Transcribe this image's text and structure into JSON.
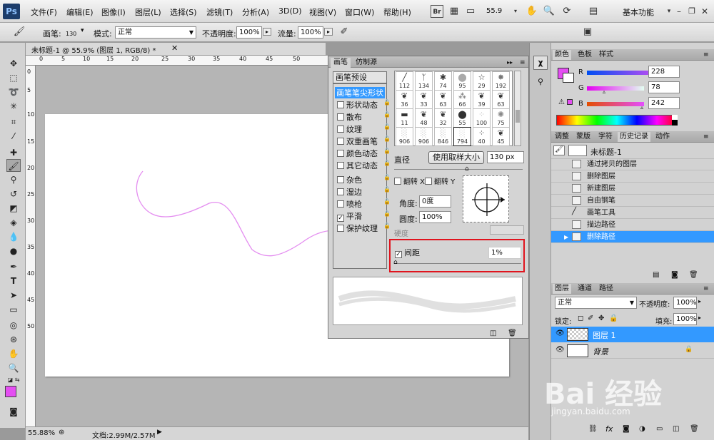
{
  "app": {
    "logo": "Ps"
  },
  "menu": [
    "文件(F)",
    "编辑(E)",
    "图像(I)",
    "图层(L)",
    "选择(S)",
    "滤镜(T)",
    "分析(A)",
    "3D(D)",
    "视图(V)",
    "窗口(W)",
    "帮助(H)"
  ],
  "appbar": {
    "bridge": "Br",
    "zoom": "55.9",
    "workspace": "基本功能"
  },
  "options": {
    "brush_label": "画笔:",
    "brush_size": "130",
    "mode_label": "模式:",
    "mode_value": "正常",
    "opacity_label": "不透明度:",
    "opacity_value": "100%",
    "flow_label": "流量:",
    "flow_value": "100%"
  },
  "document": {
    "tab_title": "未标题-1 @ 55.9% (图层 1, RGB/8) *",
    "zoom": "55.88%",
    "doc_info": "文档:2.99M/2.57M"
  },
  "ruler": {
    "h_ticks": [
      "0",
      "5",
      "10",
      "15",
      "20",
      "25",
      "30",
      "35",
      "40",
      "45",
      "50"
    ],
    "v_ticks": [
      "0",
      "5",
      "10",
      "15",
      "20",
      "25",
      "30",
      "35",
      "40",
      "45",
      "50"
    ]
  },
  "brush_panel": {
    "tabs": [
      "画笔",
      "仿制源"
    ],
    "presets_button": "画笔预设",
    "items": [
      {
        "label": "画笔笔尖形状",
        "checkbox": false,
        "selected": true
      },
      {
        "label": "形状动态",
        "checkbox": true,
        "checked": false
      },
      {
        "label": "散布",
        "checkbox": true,
        "checked": false
      },
      {
        "label": "纹理",
        "checkbox": true,
        "checked": false
      },
      {
        "label": "双重画笔",
        "checkbox": true,
        "checked": false
      },
      {
        "label": "颜色动态",
        "checkbox": true,
        "checked": false
      },
      {
        "label": "其它动态",
        "checkbox": true,
        "checked": false
      },
      {
        "label": "杂色",
        "checkbox": true,
        "checked": false
      },
      {
        "label": "湿边",
        "checkbox": true,
        "checked": false
      },
      {
        "label": "喷枪",
        "checkbox": true,
        "checked": false
      },
      {
        "label": "平滑",
        "checkbox": true,
        "checked": true
      },
      {
        "label": "保护纹理",
        "checkbox": true,
        "checked": false
      }
    ],
    "presets": [
      "112",
      "134",
      "74",
      "95",
      "29",
      "192",
      "36",
      "33",
      "63",
      "66",
      "39",
      "63",
      "11",
      "48",
      "32",
      "55",
      "100",
      "75",
      "906",
      "906",
      "846",
      "794",
      "40",
      "45"
    ],
    "diameter_label": "直径",
    "use_sample_button": "使用取样大小",
    "diameter_value": "130 px",
    "flip_x": "翻转 X",
    "flip_y": "翻转 Y",
    "angle_label": "角度:",
    "angle_value": "0度",
    "roundness_label": "圆度:",
    "roundness_value": "100%",
    "hardness_label": "硬度",
    "spacing_label": "间距",
    "spacing_value": "1%",
    "spacing_checked": true,
    "highlight_color": "#e0141e"
  },
  "color_panel": {
    "tabs": [
      "颜色",
      "色板",
      "样式"
    ],
    "channels": [
      {
        "label": "R",
        "value": "228",
        "fraction": 0.894
      },
      {
        "label": "G",
        "value": "78",
        "fraction": 0.306
      },
      {
        "label": "B",
        "value": "242",
        "fraction": 0.949
      }
    ],
    "foreground": "#e44ef2"
  },
  "history_panel": {
    "tabs": [
      "调整",
      "蒙版",
      "字符",
      "历史记录",
      "动作"
    ],
    "snapshot": "未标题-1",
    "items": [
      "通过拷贝的图层",
      "删除图层",
      "新建图层",
      "自由钢笔",
      "画笔工具",
      "描边路径",
      "删除路径"
    ],
    "selected_index": 6
  },
  "layers_panel": {
    "tabs": [
      "图层",
      "通道",
      "路径"
    ],
    "blend_mode": "正常",
    "opacity_label": "不透明度:",
    "opacity_value": "100%",
    "lock_label": "锁定:",
    "fill_label": "填充:",
    "fill_value": "100%",
    "layers": [
      {
        "name": "图层 1",
        "selected": true
      },
      {
        "name": "背景",
        "selected": false
      }
    ]
  },
  "watermark": {
    "text": "Bai 经验",
    "url": "jingyan.baidu.com"
  },
  "colors": {
    "accent": "#3399ff",
    "stroke": "#e48ef0"
  }
}
